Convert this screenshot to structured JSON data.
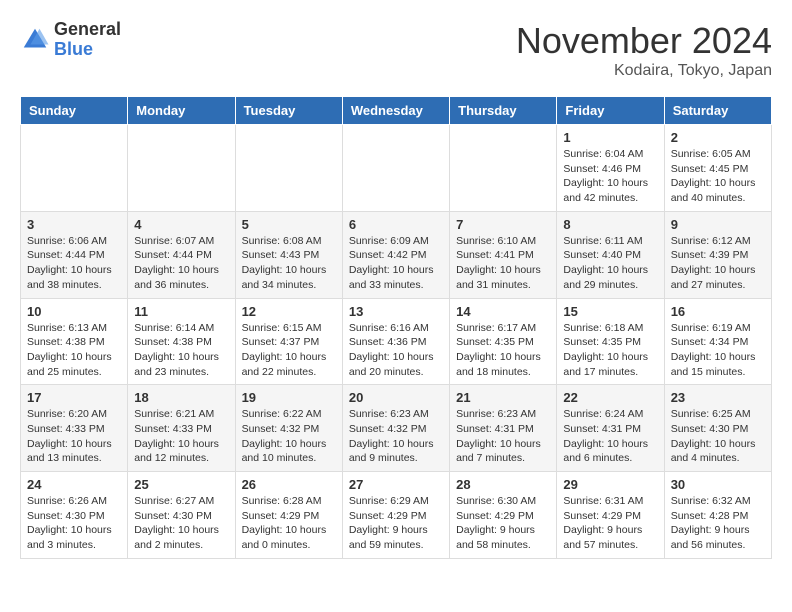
{
  "header": {
    "logo_general": "General",
    "logo_blue": "Blue",
    "month_title": "November 2024",
    "location": "Kodaira, Tokyo, Japan"
  },
  "days_of_week": [
    "Sunday",
    "Monday",
    "Tuesday",
    "Wednesday",
    "Thursday",
    "Friday",
    "Saturday"
  ],
  "weeks": [
    [
      {
        "day": "",
        "content": ""
      },
      {
        "day": "",
        "content": ""
      },
      {
        "day": "",
        "content": ""
      },
      {
        "day": "",
        "content": ""
      },
      {
        "day": "",
        "content": ""
      },
      {
        "day": "1",
        "content": "Sunrise: 6:04 AM\nSunset: 4:46 PM\nDaylight: 10 hours and 42 minutes."
      },
      {
        "day": "2",
        "content": "Sunrise: 6:05 AM\nSunset: 4:45 PM\nDaylight: 10 hours and 40 minutes."
      }
    ],
    [
      {
        "day": "3",
        "content": "Sunrise: 6:06 AM\nSunset: 4:44 PM\nDaylight: 10 hours and 38 minutes."
      },
      {
        "day": "4",
        "content": "Sunrise: 6:07 AM\nSunset: 4:44 PM\nDaylight: 10 hours and 36 minutes."
      },
      {
        "day": "5",
        "content": "Sunrise: 6:08 AM\nSunset: 4:43 PM\nDaylight: 10 hours and 34 minutes."
      },
      {
        "day": "6",
        "content": "Sunrise: 6:09 AM\nSunset: 4:42 PM\nDaylight: 10 hours and 33 minutes."
      },
      {
        "day": "7",
        "content": "Sunrise: 6:10 AM\nSunset: 4:41 PM\nDaylight: 10 hours and 31 minutes."
      },
      {
        "day": "8",
        "content": "Sunrise: 6:11 AM\nSunset: 4:40 PM\nDaylight: 10 hours and 29 minutes."
      },
      {
        "day": "9",
        "content": "Sunrise: 6:12 AM\nSunset: 4:39 PM\nDaylight: 10 hours and 27 minutes."
      }
    ],
    [
      {
        "day": "10",
        "content": "Sunrise: 6:13 AM\nSunset: 4:38 PM\nDaylight: 10 hours and 25 minutes."
      },
      {
        "day": "11",
        "content": "Sunrise: 6:14 AM\nSunset: 4:38 PM\nDaylight: 10 hours and 23 minutes."
      },
      {
        "day": "12",
        "content": "Sunrise: 6:15 AM\nSunset: 4:37 PM\nDaylight: 10 hours and 22 minutes."
      },
      {
        "day": "13",
        "content": "Sunrise: 6:16 AM\nSunset: 4:36 PM\nDaylight: 10 hours and 20 minutes."
      },
      {
        "day": "14",
        "content": "Sunrise: 6:17 AM\nSunset: 4:35 PM\nDaylight: 10 hours and 18 minutes."
      },
      {
        "day": "15",
        "content": "Sunrise: 6:18 AM\nSunset: 4:35 PM\nDaylight: 10 hours and 17 minutes."
      },
      {
        "day": "16",
        "content": "Sunrise: 6:19 AM\nSunset: 4:34 PM\nDaylight: 10 hours and 15 minutes."
      }
    ],
    [
      {
        "day": "17",
        "content": "Sunrise: 6:20 AM\nSunset: 4:33 PM\nDaylight: 10 hours and 13 minutes."
      },
      {
        "day": "18",
        "content": "Sunrise: 6:21 AM\nSunset: 4:33 PM\nDaylight: 10 hours and 12 minutes."
      },
      {
        "day": "19",
        "content": "Sunrise: 6:22 AM\nSunset: 4:32 PM\nDaylight: 10 hours and 10 minutes."
      },
      {
        "day": "20",
        "content": "Sunrise: 6:23 AM\nSunset: 4:32 PM\nDaylight: 10 hours and 9 minutes."
      },
      {
        "day": "21",
        "content": "Sunrise: 6:23 AM\nSunset: 4:31 PM\nDaylight: 10 hours and 7 minutes."
      },
      {
        "day": "22",
        "content": "Sunrise: 6:24 AM\nSunset: 4:31 PM\nDaylight: 10 hours and 6 minutes."
      },
      {
        "day": "23",
        "content": "Sunrise: 6:25 AM\nSunset: 4:30 PM\nDaylight: 10 hours and 4 minutes."
      }
    ],
    [
      {
        "day": "24",
        "content": "Sunrise: 6:26 AM\nSunset: 4:30 PM\nDaylight: 10 hours and 3 minutes."
      },
      {
        "day": "25",
        "content": "Sunrise: 6:27 AM\nSunset: 4:30 PM\nDaylight: 10 hours and 2 minutes."
      },
      {
        "day": "26",
        "content": "Sunrise: 6:28 AM\nSunset: 4:29 PM\nDaylight: 10 hours and 0 minutes."
      },
      {
        "day": "27",
        "content": "Sunrise: 6:29 AM\nSunset: 4:29 PM\nDaylight: 9 hours and 59 minutes."
      },
      {
        "day": "28",
        "content": "Sunrise: 6:30 AM\nSunset: 4:29 PM\nDaylight: 9 hours and 58 minutes."
      },
      {
        "day": "29",
        "content": "Sunrise: 6:31 AM\nSunset: 4:29 PM\nDaylight: 9 hours and 57 minutes."
      },
      {
        "day": "30",
        "content": "Sunrise: 6:32 AM\nSunset: 4:28 PM\nDaylight: 9 hours and 56 minutes."
      }
    ]
  ]
}
